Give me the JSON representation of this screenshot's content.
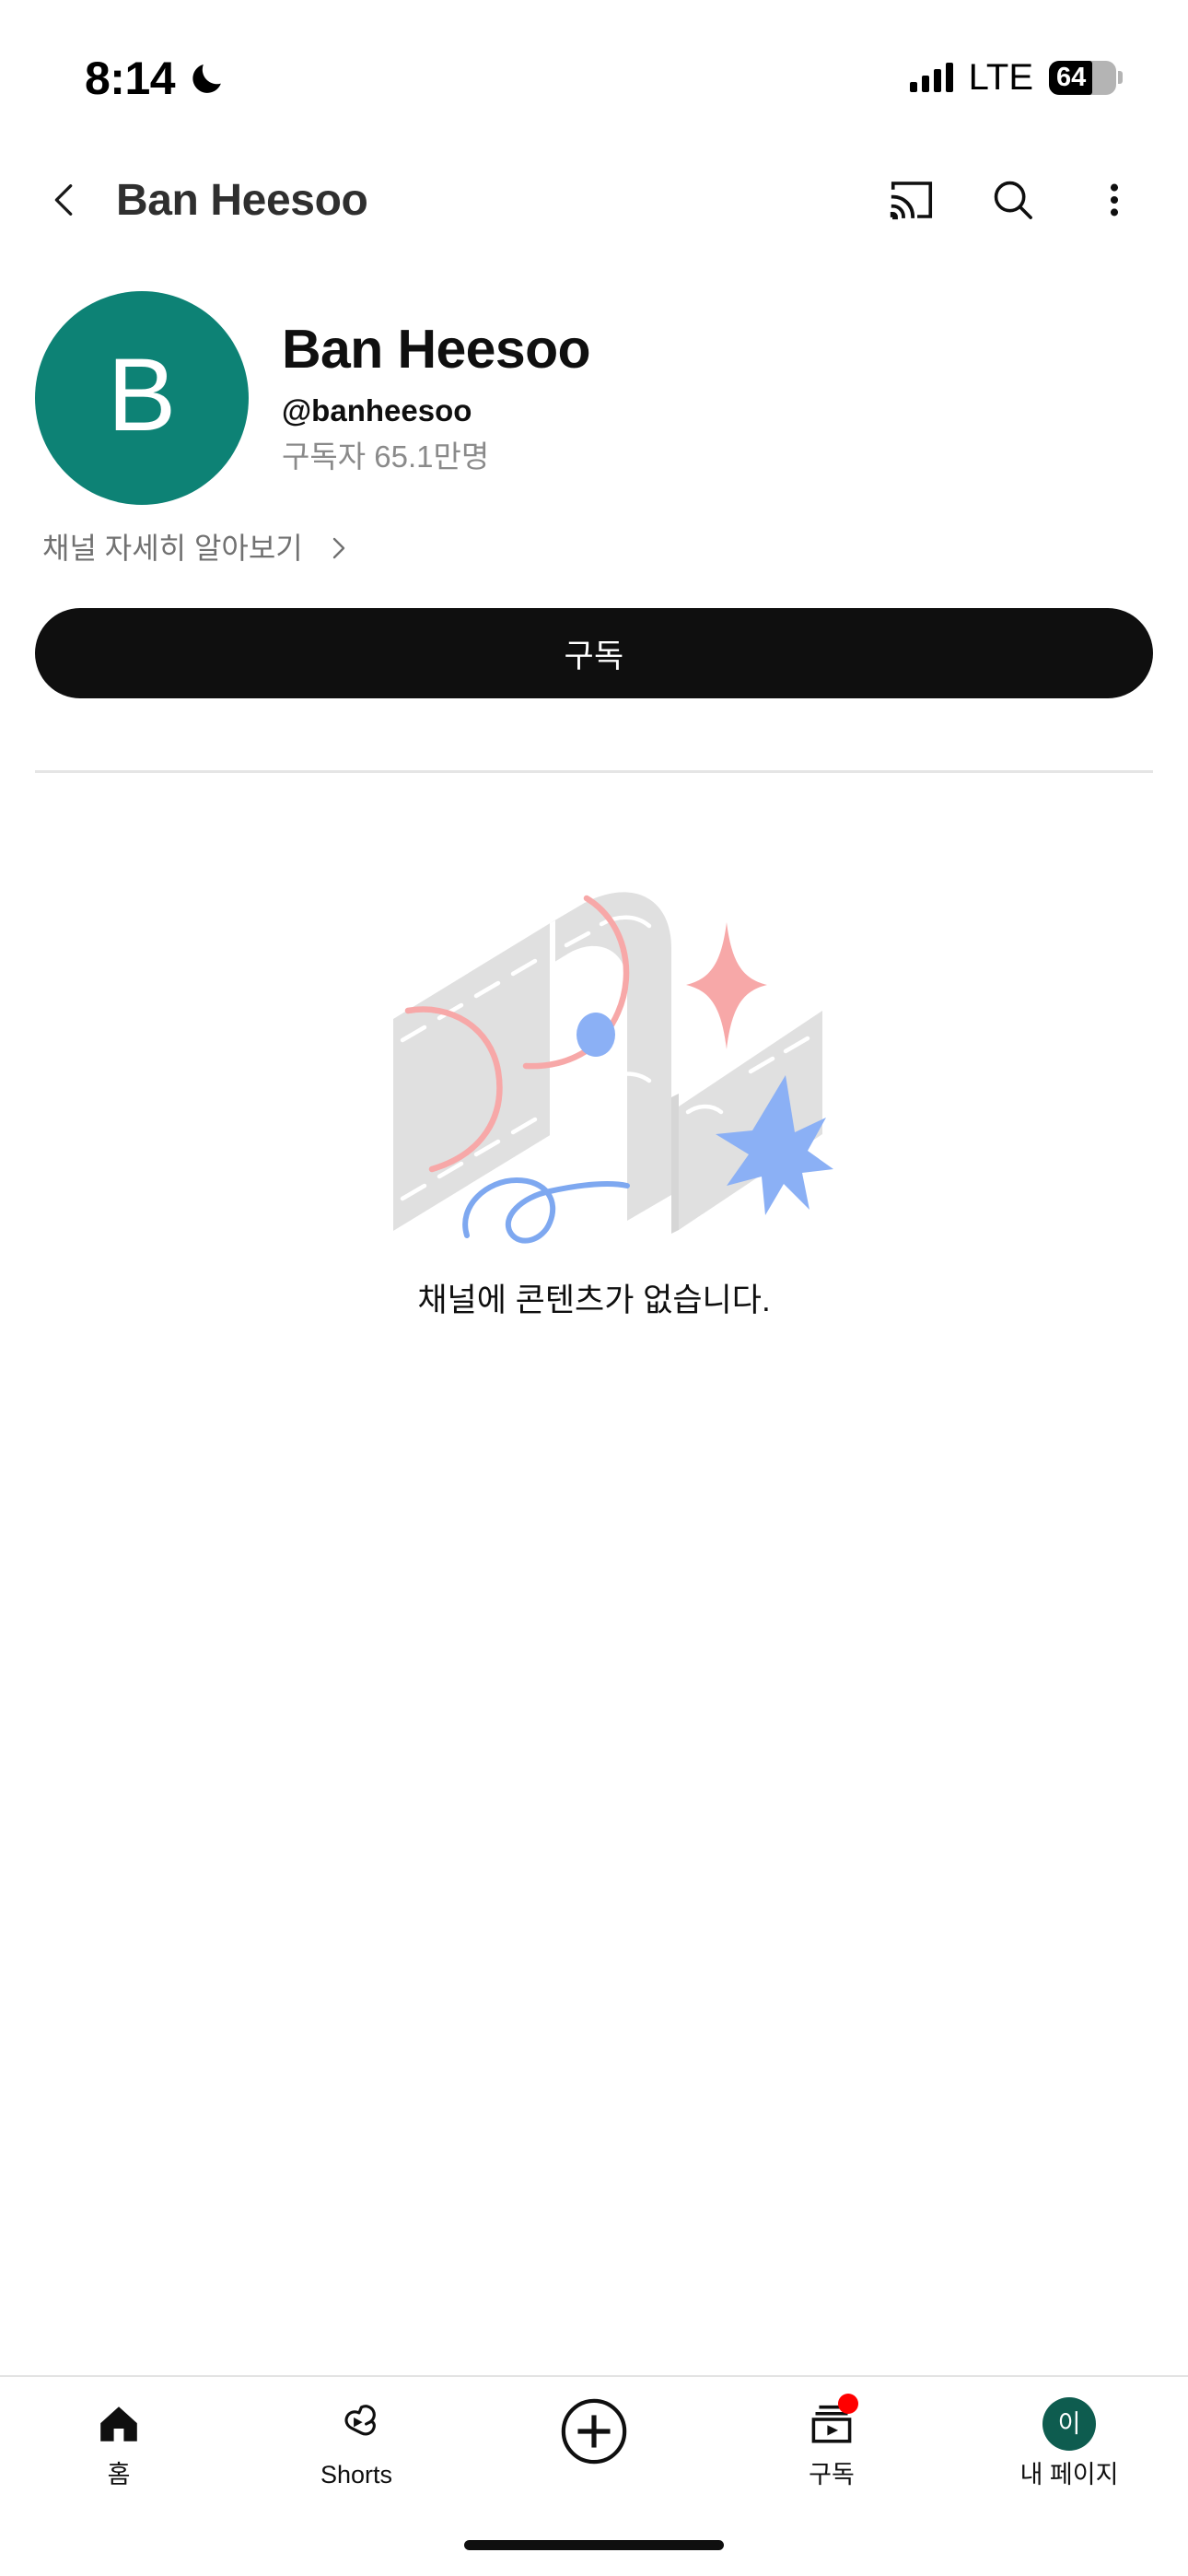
{
  "status_bar": {
    "time": "8:14",
    "dnd_icon": "crescent-moon-icon",
    "signal_icon": "cellular-signal-icon",
    "network": "LTE",
    "battery_percent": "64",
    "battery_level": 64
  },
  "app_header": {
    "back_icon": "chevron-left-icon",
    "title": "Ban Heesoo",
    "cast_icon": "cast-icon",
    "search_icon": "search-icon",
    "overflow_icon": "more-vertical-icon"
  },
  "channel": {
    "avatar_letter": "B",
    "avatar_color": "#0d8275",
    "name": "Ban Heesoo",
    "handle": "@banheesoo",
    "subscribers": "구독자 65.1만명",
    "learn_more_label": "채널 자세히 알아보기",
    "learn_more_chevron": "chevron-right-icon",
    "subscribe_label": "구독",
    "subscribe_bg": "#0f0f0f"
  },
  "empty_state": {
    "illustration_name": "no-content-map-illustration",
    "message": "채널에 콘텐츠가 없습니다.",
    "colors": {
      "road_gray": "#e0e0e0",
      "sparkle_pink": "#f7a8a8",
      "accent_blue": "#8bb0f5",
      "dash_white": "#ffffff"
    }
  },
  "bottom_nav": {
    "items": [
      {
        "label": "홈",
        "icon": "home-icon",
        "active": true
      },
      {
        "label": "Shorts",
        "icon": "shorts-icon",
        "active": false
      },
      {
        "label": "",
        "icon": "create-plus-icon",
        "active": false
      },
      {
        "label": "구독",
        "icon": "subscriptions-icon",
        "active": false,
        "badge_color": "#ff0000"
      },
      {
        "label": "내 페이지",
        "icon": "account-avatar-icon",
        "active": false,
        "avatar_letter": "이",
        "avatar_color": "#0e5c4f"
      }
    ]
  },
  "home_indicator": {
    "name": "home-indicator"
  }
}
